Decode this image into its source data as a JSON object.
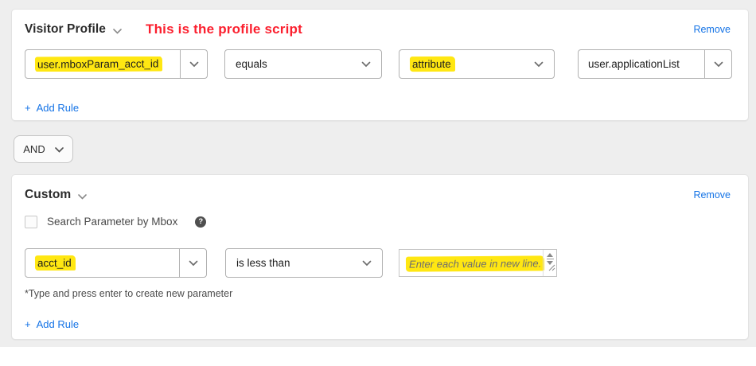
{
  "colors": {
    "accent_blue": "#1473e6",
    "highlight_yellow": "#ffe712",
    "annotation_red": "#fb1f2e"
  },
  "visitor_profile_card": {
    "title": "Visitor Profile",
    "annotation": "This is the profile script",
    "remove_label": "Remove",
    "add_rule_plus": "+",
    "add_rule_label": "Add Rule",
    "rule": {
      "parameter_value": "user.mboxParam_acct_id",
      "operator_value": "equals",
      "value_type_value": "attribute",
      "target_value": "user.applicationList"
    }
  },
  "combiner": {
    "operator_label": "AND"
  },
  "custom_card": {
    "title": "Custom",
    "remove_label": "Remove",
    "mbox_checkbox_label": "Search Parameter by Mbox",
    "help_icon_glyph": "?",
    "footnote": "*Type and press enter to create new parameter",
    "add_rule_plus": "+",
    "add_rule_label": "Add Rule",
    "rule": {
      "parameter_value": "acct_id",
      "operator_value": "is less than",
      "value_placeholder": "Enter each value in new line."
    }
  }
}
